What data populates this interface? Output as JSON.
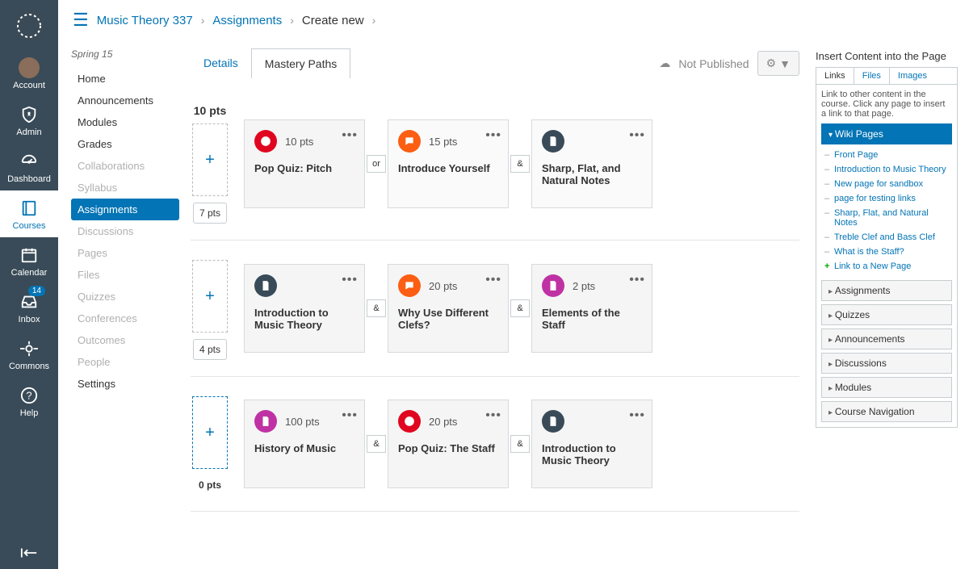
{
  "global_nav": {
    "items": [
      {
        "label": "Account"
      },
      {
        "label": "Admin"
      },
      {
        "label": "Dashboard"
      },
      {
        "label": "Courses"
      },
      {
        "label": "Calendar"
      },
      {
        "label": "Inbox",
        "badge": "14"
      },
      {
        "label": "Commons"
      },
      {
        "label": "Help"
      }
    ]
  },
  "breadcrumb": {
    "course": "Music Theory 337",
    "section": "Assignments",
    "current": "Create new"
  },
  "course_nav": {
    "term": "Spring 15",
    "items": [
      {
        "label": "Home",
        "state": ""
      },
      {
        "label": "Announcements",
        "state": ""
      },
      {
        "label": "Modules",
        "state": ""
      },
      {
        "label": "Grades",
        "state": ""
      },
      {
        "label": "Collaborations",
        "state": "disabled"
      },
      {
        "label": "Syllabus",
        "state": "disabled"
      },
      {
        "label": "Assignments",
        "state": "active"
      },
      {
        "label": "Discussions",
        "state": "disabled"
      },
      {
        "label": "Pages",
        "state": "disabled"
      },
      {
        "label": "Files",
        "state": "disabled"
      },
      {
        "label": "Quizzes",
        "state": "disabled"
      },
      {
        "label": "Conferences",
        "state": "disabled"
      },
      {
        "label": "Outcomes",
        "state": "disabled"
      },
      {
        "label": "People",
        "state": "disabled"
      },
      {
        "label": "Settings",
        "state": ""
      }
    ]
  },
  "header": {
    "tab_details": "Details",
    "tab_mastery": "Mastery Paths",
    "status": "Not Published"
  },
  "rows": [
    {
      "top": "10 pts",
      "bottom": "7 pts",
      "bottom_boxed": true,
      "slot_active": false,
      "items": [
        {
          "conj": null,
          "color": "c-red",
          "icon": "quiz",
          "pts": "10 pts",
          "title": "Pop Quiz: Pitch",
          "light": false
        },
        {
          "conj": "or",
          "color": "c-orange",
          "icon": "discussion",
          "pts": "15 pts",
          "title": "Introduce Yourself",
          "light": true
        },
        {
          "conj": "&",
          "color": "c-dark",
          "icon": "page",
          "pts": "",
          "title": "Sharp, Flat, and Natural Notes",
          "light": true
        }
      ]
    },
    {
      "top": "",
      "bottom": "4 pts",
      "bottom_boxed": true,
      "slot_active": false,
      "items": [
        {
          "conj": null,
          "color": "c-dark",
          "icon": "page",
          "pts": "",
          "title": "Introduction to Music Theory",
          "light": false
        },
        {
          "conj": "&",
          "color": "c-orange",
          "icon": "discussion",
          "pts": "20 pts",
          "title": "Why Use Different Clefs?",
          "light": false
        },
        {
          "conj": "&",
          "color": "c-magenta",
          "icon": "page",
          "pts": "2 pts",
          "title": "Elements of the Staff",
          "light": false
        }
      ]
    },
    {
      "top": "",
      "bottom": "0 pts",
      "bottom_boxed": false,
      "slot_active": true,
      "items": [
        {
          "conj": null,
          "color": "c-magenta",
          "icon": "page",
          "pts": "100 pts",
          "title": "History of Music",
          "light": false
        },
        {
          "conj": "&",
          "color": "c-red",
          "icon": "quiz",
          "pts": "20 pts",
          "title": "Pop Quiz: The Staff",
          "light": false
        },
        {
          "conj": "&",
          "color": "c-dark",
          "icon": "page",
          "pts": "",
          "title": "Introduction to Music Theory",
          "light": false
        }
      ]
    }
  ],
  "sidebar": {
    "title": "Insert Content into the Page",
    "tabs": [
      "Links",
      "Files",
      "Images"
    ],
    "hint": "Link to other content in the course. Click any page to insert a link to that page.",
    "open_section": "Wiki Pages",
    "pages": [
      "Front Page",
      "Introduction to Music Theory",
      "New page for sandbox",
      "page for testing links",
      "Sharp, Flat, and Natural Notes",
      "Treble Clef and Bass Clef",
      "What is the Staff?"
    ],
    "new_page": "Link to a New Page",
    "sections": [
      "Assignments",
      "Quizzes",
      "Announcements",
      "Discussions",
      "Modules",
      "Course Navigation"
    ]
  }
}
